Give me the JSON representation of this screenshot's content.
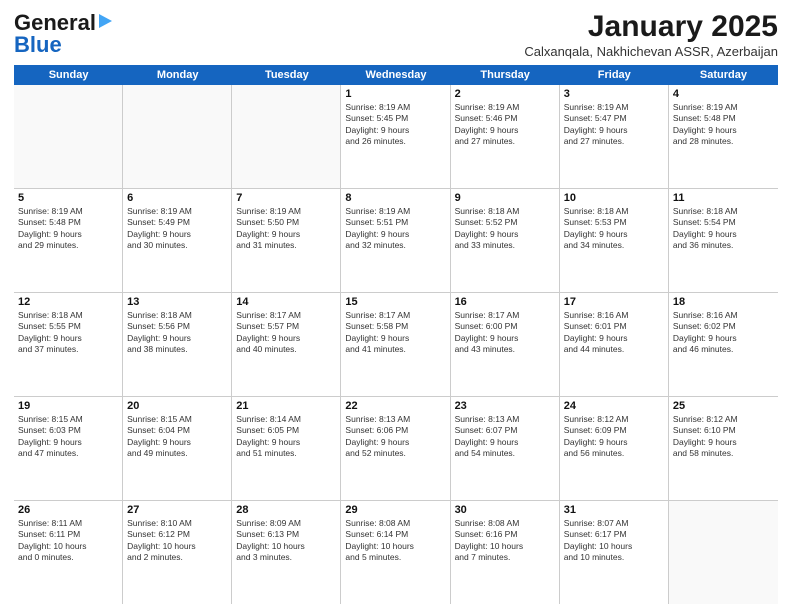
{
  "header": {
    "logo_line1": "General",
    "logo_line2": "Blue",
    "month_title": "January 2025",
    "location": "Calxanqala, Nakhichevan ASSR, Azerbaijan"
  },
  "calendar": {
    "days_of_week": [
      "Sunday",
      "Monday",
      "Tuesday",
      "Wednesday",
      "Thursday",
      "Friday",
      "Saturday"
    ],
    "weeks": [
      [
        {
          "day": "",
          "text": ""
        },
        {
          "day": "",
          "text": ""
        },
        {
          "day": "",
          "text": ""
        },
        {
          "day": "1",
          "text": "Sunrise: 8:19 AM\nSunset: 5:45 PM\nDaylight: 9 hours\nand 26 minutes."
        },
        {
          "day": "2",
          "text": "Sunrise: 8:19 AM\nSunset: 5:46 PM\nDaylight: 9 hours\nand 27 minutes."
        },
        {
          "day": "3",
          "text": "Sunrise: 8:19 AM\nSunset: 5:47 PM\nDaylight: 9 hours\nand 27 minutes."
        },
        {
          "day": "4",
          "text": "Sunrise: 8:19 AM\nSunset: 5:48 PM\nDaylight: 9 hours\nand 28 minutes."
        }
      ],
      [
        {
          "day": "5",
          "text": "Sunrise: 8:19 AM\nSunset: 5:48 PM\nDaylight: 9 hours\nand 29 minutes."
        },
        {
          "day": "6",
          "text": "Sunrise: 8:19 AM\nSunset: 5:49 PM\nDaylight: 9 hours\nand 30 minutes."
        },
        {
          "day": "7",
          "text": "Sunrise: 8:19 AM\nSunset: 5:50 PM\nDaylight: 9 hours\nand 31 minutes."
        },
        {
          "day": "8",
          "text": "Sunrise: 8:19 AM\nSunset: 5:51 PM\nDaylight: 9 hours\nand 32 minutes."
        },
        {
          "day": "9",
          "text": "Sunrise: 8:18 AM\nSunset: 5:52 PM\nDaylight: 9 hours\nand 33 minutes."
        },
        {
          "day": "10",
          "text": "Sunrise: 8:18 AM\nSunset: 5:53 PM\nDaylight: 9 hours\nand 34 minutes."
        },
        {
          "day": "11",
          "text": "Sunrise: 8:18 AM\nSunset: 5:54 PM\nDaylight: 9 hours\nand 36 minutes."
        }
      ],
      [
        {
          "day": "12",
          "text": "Sunrise: 8:18 AM\nSunset: 5:55 PM\nDaylight: 9 hours\nand 37 minutes."
        },
        {
          "day": "13",
          "text": "Sunrise: 8:18 AM\nSunset: 5:56 PM\nDaylight: 9 hours\nand 38 minutes."
        },
        {
          "day": "14",
          "text": "Sunrise: 8:17 AM\nSunset: 5:57 PM\nDaylight: 9 hours\nand 40 minutes."
        },
        {
          "day": "15",
          "text": "Sunrise: 8:17 AM\nSunset: 5:58 PM\nDaylight: 9 hours\nand 41 minutes."
        },
        {
          "day": "16",
          "text": "Sunrise: 8:17 AM\nSunset: 6:00 PM\nDaylight: 9 hours\nand 43 minutes."
        },
        {
          "day": "17",
          "text": "Sunrise: 8:16 AM\nSunset: 6:01 PM\nDaylight: 9 hours\nand 44 minutes."
        },
        {
          "day": "18",
          "text": "Sunrise: 8:16 AM\nSunset: 6:02 PM\nDaylight: 9 hours\nand 46 minutes."
        }
      ],
      [
        {
          "day": "19",
          "text": "Sunrise: 8:15 AM\nSunset: 6:03 PM\nDaylight: 9 hours\nand 47 minutes."
        },
        {
          "day": "20",
          "text": "Sunrise: 8:15 AM\nSunset: 6:04 PM\nDaylight: 9 hours\nand 49 minutes."
        },
        {
          "day": "21",
          "text": "Sunrise: 8:14 AM\nSunset: 6:05 PM\nDaylight: 9 hours\nand 51 minutes."
        },
        {
          "day": "22",
          "text": "Sunrise: 8:13 AM\nSunset: 6:06 PM\nDaylight: 9 hours\nand 52 minutes."
        },
        {
          "day": "23",
          "text": "Sunrise: 8:13 AM\nSunset: 6:07 PM\nDaylight: 9 hours\nand 54 minutes."
        },
        {
          "day": "24",
          "text": "Sunrise: 8:12 AM\nSunset: 6:09 PM\nDaylight: 9 hours\nand 56 minutes."
        },
        {
          "day": "25",
          "text": "Sunrise: 8:12 AM\nSunset: 6:10 PM\nDaylight: 9 hours\nand 58 minutes."
        }
      ],
      [
        {
          "day": "26",
          "text": "Sunrise: 8:11 AM\nSunset: 6:11 PM\nDaylight: 10 hours\nand 0 minutes."
        },
        {
          "day": "27",
          "text": "Sunrise: 8:10 AM\nSunset: 6:12 PM\nDaylight: 10 hours\nand 2 minutes."
        },
        {
          "day": "28",
          "text": "Sunrise: 8:09 AM\nSunset: 6:13 PM\nDaylight: 10 hours\nand 3 minutes."
        },
        {
          "day": "29",
          "text": "Sunrise: 8:08 AM\nSunset: 6:14 PM\nDaylight: 10 hours\nand 5 minutes."
        },
        {
          "day": "30",
          "text": "Sunrise: 8:08 AM\nSunset: 6:16 PM\nDaylight: 10 hours\nand 7 minutes."
        },
        {
          "day": "31",
          "text": "Sunrise: 8:07 AM\nSunset: 6:17 PM\nDaylight: 10 hours\nand 10 minutes."
        },
        {
          "day": "",
          "text": ""
        }
      ]
    ]
  }
}
